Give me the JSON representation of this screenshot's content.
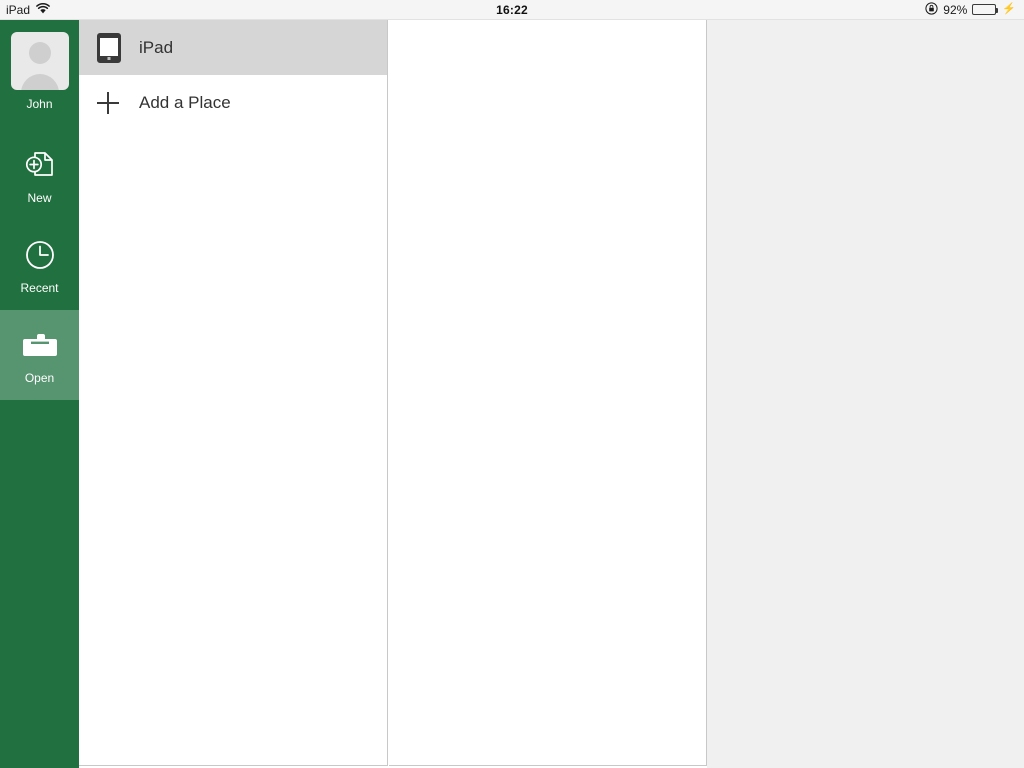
{
  "status_bar": {
    "device_label": "iPad",
    "wifi_icon": "wifi-icon",
    "time": "16:22",
    "rotation_lock_icon": "rotation-lock-icon",
    "battery_percent": "92%",
    "battery_level": 92,
    "battery_fill_color": "#4cd461",
    "charging_icon": "lightning-bolt-icon",
    "background_color": "#f5f5f5"
  },
  "sidebar": {
    "background_color": "#21703f",
    "selected_background_color": "#579470",
    "account": {
      "name": "John",
      "avatar_icon": "person-placeholder-avatar"
    },
    "items": [
      {
        "label": "New",
        "icon": "new-document-icon",
        "selected": false
      },
      {
        "label": "Recent",
        "icon": "clock-icon",
        "selected": false
      },
      {
        "label": "Open",
        "icon": "folder-icon",
        "selected": true
      }
    ]
  },
  "places": {
    "rows": [
      {
        "label": "iPad",
        "icon": "tablet-icon",
        "selected": true
      },
      {
        "label": "Add a Place",
        "icon": "plus-icon",
        "selected": false
      }
    ],
    "selected_row_color": "#d6d6d6"
  },
  "file_list": {
    "items": [],
    "background_color": "#ffffff"
  },
  "preview": {
    "background_color": "#f0f0f0",
    "content": ""
  }
}
